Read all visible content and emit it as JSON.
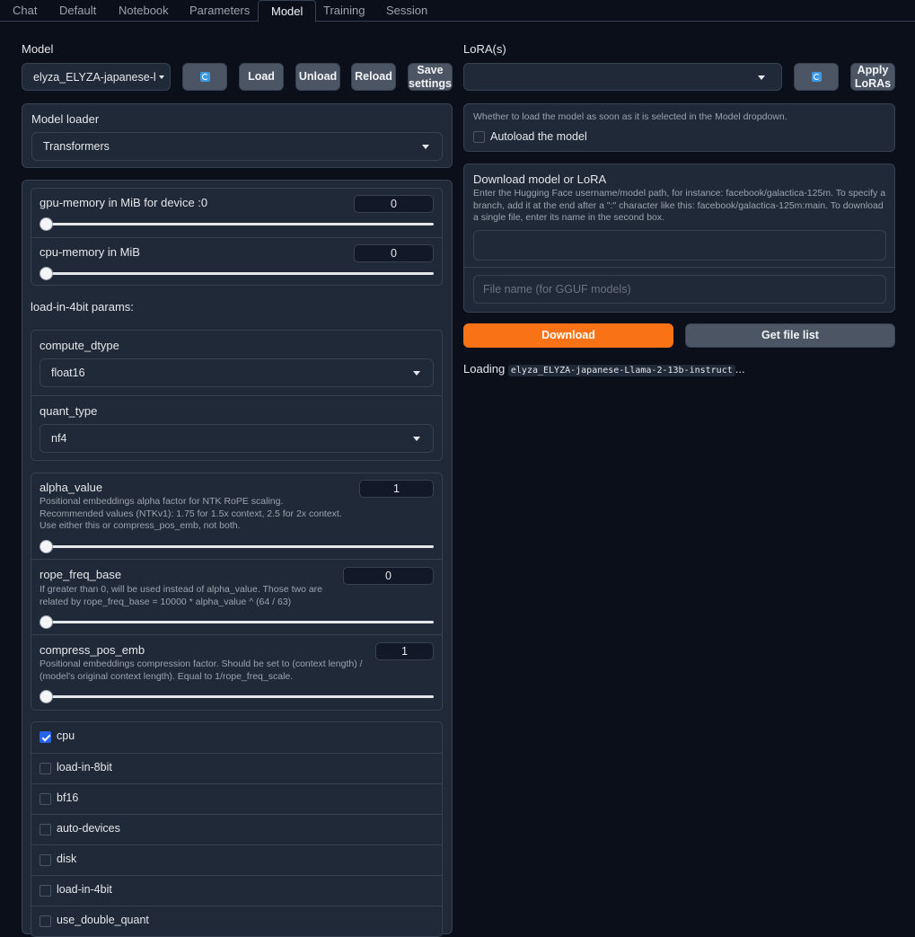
{
  "tabs": [
    "Chat",
    "Default",
    "Notebook",
    "Parameters",
    "Model",
    "Training",
    "Session"
  ],
  "model": {
    "label": "Model",
    "selected": "elyza_ELYZA-japanese-l",
    "load": "Load",
    "unload": "Unload",
    "reload": "Reload",
    "save_line1": "Save",
    "save_line2": "settings"
  },
  "loader": {
    "label": "Model loader",
    "selected": "Transformers"
  },
  "memory": {
    "gpu_label": "gpu-memory in MiB for device :0",
    "gpu_value": "0",
    "cpu_label": "cpu-memory in MiB",
    "cpu_value": "0"
  },
  "fourbit": {
    "heading": "load-in-4bit params:",
    "compute_label": "compute_dtype",
    "compute_value": "float16",
    "quant_label": "quant_type",
    "quant_value": "nf4"
  },
  "rope": {
    "alpha_label": "alpha_value",
    "alpha_desc": "Positional embeddings alpha factor for NTK RoPE scaling. Recommended values (NTKv1): 1.75 for 1.5x context, 2.5 for 2x context. Use either this or compress_pos_emb, not both.",
    "alpha_value": "1",
    "freq_label": "rope_freq_base",
    "freq_desc": "If greater than 0, will be used instead of alpha_value. Those two are related by rope_freq_base = 10000 * alpha_value ^ (64 / 63)",
    "freq_value": "0",
    "compress_label": "compress_pos_emb",
    "compress_desc": "Positional embeddings compression factor. Should be set to (context length) / (model's original context length). Equal to 1/rope_freq_scale.",
    "compress_value": "1"
  },
  "checkboxes": [
    {
      "label": "cpu",
      "checked": true
    },
    {
      "label": "load-in-8bit",
      "checked": false
    },
    {
      "label": "bf16",
      "checked": false
    },
    {
      "label": "auto-devices",
      "checked": false
    },
    {
      "label": "disk",
      "checked": false
    },
    {
      "label": "load-in-4bit",
      "checked": false
    },
    {
      "label": "use_double_quant",
      "checked": false
    }
  ],
  "lora": {
    "label": "LoRA(s)",
    "apply_line1": "Apply",
    "apply_line2": "LoRAs"
  },
  "autoload": {
    "desc": "Whether to load the model as soon as it is selected in the Model dropdown.",
    "label": "Autoload the model"
  },
  "download": {
    "title": "Download model or LoRA",
    "desc": "Enter the Hugging Face username/model path, for instance: facebook/galactica-125m. To specify a branch, add it at the end after a \":\" character like this: facebook/galactica-125m:main. To download a single file, enter its name in the second box.",
    "file_placeholder": "File name (for GGUF models)",
    "download_btn": "Download",
    "filelist_btn": "Get file list"
  },
  "status": {
    "prefix": "Loading ",
    "model_name": "elyza_ELYZA-japanese-Llama-2-13b-instruct",
    "suffix": "..."
  },
  "colors": {
    "accent": "#f97316",
    "checkbox": "#2563eb",
    "background": "#0b0f19",
    "panel": "#1f2937"
  }
}
